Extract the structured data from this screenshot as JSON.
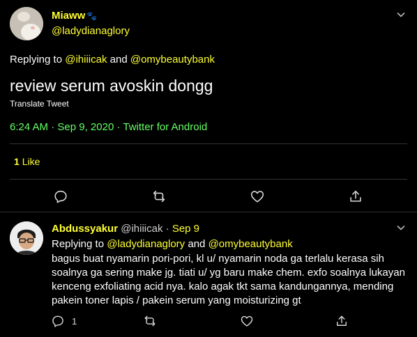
{
  "main_tweet": {
    "display_name": "Miaww",
    "name_emoji": "🐾",
    "handle": "@ladydianaglory",
    "replying_prefix": "Replying to ",
    "replying_user_1": "@ihiiicak",
    "replying_and": " and ",
    "replying_user_2": "@omybeautybank",
    "text": "review serum avoskin dongg",
    "translate_label": "Translate Tweet",
    "time": "6:24 AM",
    "date": "Sep 9, 2020",
    "source": "Twitter for Android",
    "meta_separator": " · ",
    "likes_count": "1",
    "likes_label": "Like"
  },
  "reply_tweet": {
    "display_name": "Abdussyakur",
    "handle": "@ihiiicak",
    "date_separator": " · ",
    "date": "Sep 9",
    "replying_prefix": "Replying to ",
    "replying_user_1": "@ladydianaglory",
    "replying_and": " and ",
    "replying_user_2": "@omybeautybank",
    "text_line_1": "bagus buat nyamarin pori-pori, kl u/ nyamarin noda ga terlalu kerasa sih",
    "text_line_2": "soalnya ga sering make jg. tiati u/ yg baru make chem. exfo soalnya lukayan",
    "text_line_3": "kenceng exfoliating acid nya. kalo agak tkt sama kandungannya, mending",
    "text_line_4": "pakein toner lapis / pakein serum yang moisturizing gt",
    "reply_count": "1"
  },
  "colors": {
    "background": "#000000",
    "accent_yellow": "#ffff33",
    "timestamp_green": "#66ff66",
    "divider": "#2f3336"
  },
  "icons": [
    "chevron-down-icon",
    "reply-icon",
    "retweet-icon",
    "like-icon",
    "share-icon"
  ]
}
